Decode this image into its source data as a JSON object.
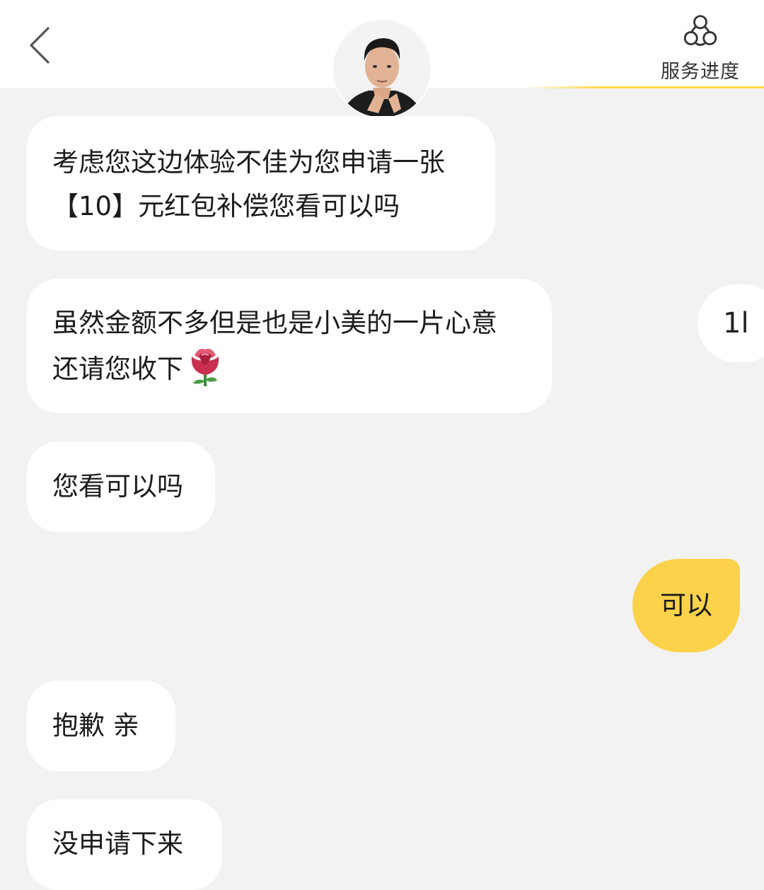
{
  "header": {
    "back_icon": "chevron-left-icon",
    "avatar_icon": "agent-avatar",
    "service_icon": "service-progress-icon",
    "service_label": "服务进度",
    "accent_color": "#fcd24a"
  },
  "messages": [
    {
      "from": "agent",
      "lines": [
        "考虑您这边体验不佳为您申请一张",
        "【10】元红包补偿您看可以吗"
      ]
    },
    {
      "from": "agent",
      "lines": [
        "虽然金额不多但是也是小美的一片心意",
        "还请您收下"
      ],
      "emoji": "rose-emoji"
    },
    {
      "from": "agent",
      "lines": [
        "您看可以吗"
      ]
    },
    {
      "from": "user",
      "lines": [
        "可以"
      ]
    },
    {
      "from": "agent",
      "lines": [
        "抱歉 亲"
      ]
    },
    {
      "from": "agent",
      "lines": [
        "没申请下来"
      ]
    }
  ],
  "side_chip": {
    "text": "1l"
  }
}
